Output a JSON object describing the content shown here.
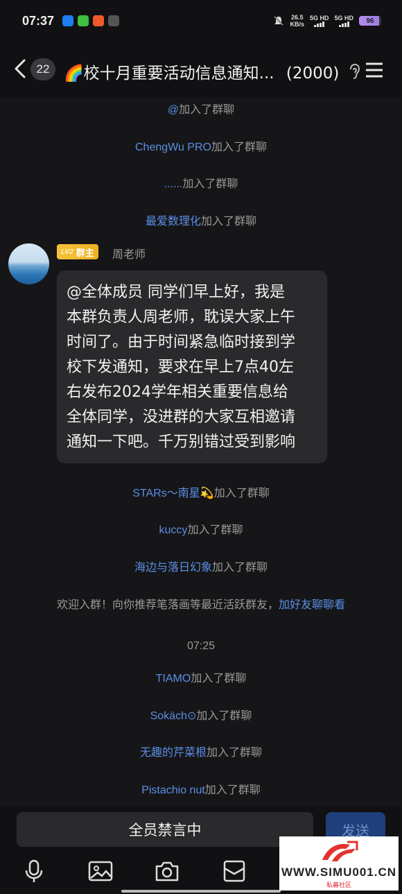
{
  "status_bar": {
    "time": "07:37",
    "network_speed": "26.5",
    "network_unit": "KB/s",
    "sim1": "5G HD",
    "sim2": "5G HD",
    "battery": "96"
  },
  "header": {
    "unread_count": "22",
    "title": "🌈校十月重要活动信息通知...",
    "member_count": "(2000)"
  },
  "messages_top": [
    {
      "name": "@",
      "suffix": "加入了群聊"
    },
    {
      "name": "ChengWu PRO",
      "suffix": "加入了群聊"
    },
    {
      "name": "......",
      "suffix": "加入了群聊"
    },
    {
      "name": "最爱数理化",
      "suffix": "加入了群聊"
    }
  ],
  "post": {
    "level": "LV2",
    "role": "群主",
    "sender": "周老师",
    "text": "@全体成员 同学们早上好，我是\n本群负责人周老师，耽误大家上午\n时间了。由于时间紧急临时接到学\n校下发通知，要求在早上7点40左\n右发布2024学年相关重要信息给\n全体同学，没进群的大家互相邀请\n通知一下吧。千万别错过受到影响"
  },
  "messages_mid": [
    {
      "name": "STARs～南星💫",
      "suffix": "加入了群聊"
    },
    {
      "name": "kuccy",
      "suffix": "加入了群聊"
    },
    {
      "name": "海边与落日幻象",
      "suffix": "加入了群聊"
    }
  ],
  "welcome": {
    "text": "欢迎入群！向你推荐笔落画等最近活跃群友，",
    "link": "加好友聊聊看"
  },
  "timestamp": "07:25",
  "messages_bottom": [
    {
      "name": "TIAMO",
      "suffix": "加入了群聊"
    },
    {
      "name": "Sokäch⊙",
      "suffix": "加入了群聊"
    },
    {
      "name": "无趣的芹菜根",
      "suffix": "加入了群聊"
    },
    {
      "name": "Pistachio nut",
      "suffix": "加入了群聊"
    }
  ],
  "input_bar": {
    "muted_label": "全员禁言中",
    "send_label": "发送"
  },
  "toolbar_icons": [
    "microphone-icon",
    "image-icon",
    "camera-icon",
    "mailbox-icon"
  ],
  "watermark": {
    "text": "WWW.SIMU001.CN",
    "sub": "私募社区"
  },
  "colors": {
    "background": "#161618",
    "link": "#5b8ee6",
    "bubble": "#2a2a2d",
    "owner_badge": "#f5c33b"
  }
}
